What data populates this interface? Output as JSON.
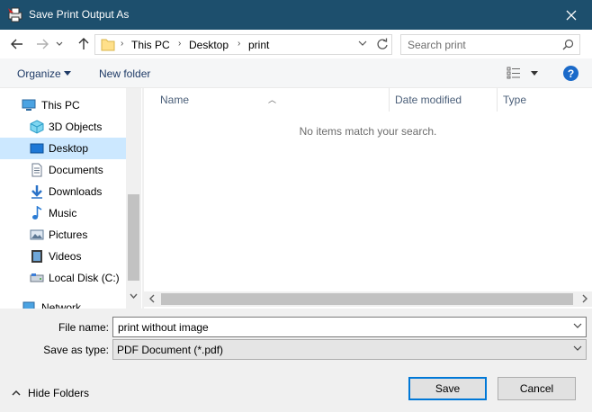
{
  "window": {
    "title": "Save Print Output As"
  },
  "nav": {
    "breadcrumb": [
      "This PC",
      "Desktop",
      "print"
    ],
    "search_placeholder": "Search print"
  },
  "toolbar": {
    "organize_label": "Organize",
    "new_folder_label": "New folder",
    "help_label": "?"
  },
  "sidebar": {
    "items": [
      {
        "label": "This PC",
        "icon": "computer-icon"
      },
      {
        "label": "3D Objects",
        "icon": "3d-objects-icon"
      },
      {
        "label": "Desktop",
        "icon": "desktop-icon",
        "selected": true
      },
      {
        "label": "Documents",
        "icon": "documents-icon"
      },
      {
        "label": "Downloads",
        "icon": "downloads-icon"
      },
      {
        "label": "Music",
        "icon": "music-icon"
      },
      {
        "label": "Pictures",
        "icon": "pictures-icon"
      },
      {
        "label": "Videos",
        "icon": "videos-icon"
      },
      {
        "label": "Local Disk (C:)",
        "icon": "local-disk-icon"
      },
      {
        "label": "Network",
        "icon": "network-icon"
      }
    ]
  },
  "content": {
    "columns": [
      "Name",
      "Date modified",
      "Type"
    ],
    "empty_message": "No items match your search."
  },
  "form": {
    "file_name_label": "File name:",
    "file_name_value": "print without image",
    "save_type_label": "Save as type:",
    "save_type_value": "PDF Document (*.pdf)"
  },
  "footer": {
    "hide_folders_label": "Hide Folders",
    "save_label": "Save",
    "cancel_label": "Cancel"
  },
  "colors": {
    "titlebar": "#1d4f6d",
    "selected": "#cce8ff",
    "accent": "#0078d7"
  }
}
